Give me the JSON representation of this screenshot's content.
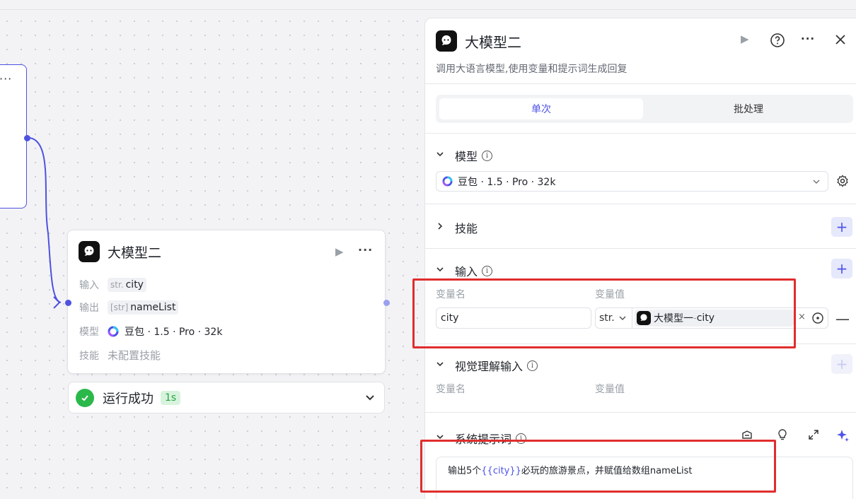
{
  "canvas": {
    "prev_node_more": "···",
    "node": {
      "title": "大模型二",
      "more": "···",
      "rows": {
        "input_label": "输入",
        "input_type": "str.",
        "input_value": "city",
        "output_label": "输出",
        "output_type": "[str]",
        "output_value": "nameList",
        "model_label": "模型",
        "model_value": "豆包 · 1.5 · Pro · 32k",
        "skill_label": "技能",
        "skill_value": "未配置技能"
      }
    },
    "status": {
      "text": "运行成功",
      "duration": "1s"
    }
  },
  "panel": {
    "title": "大模型二",
    "description": "调用大语言模型,使用变量和提示词生成回复",
    "more": "···",
    "tabs": [
      "单次",
      "批处理"
    ],
    "model_section": {
      "title": "模型",
      "selected": "豆包 · 1.5 · Pro · 32k"
    },
    "skills_section": {
      "title": "技能"
    },
    "input_section": {
      "title": "输入",
      "col_name": "变量名",
      "col_value": "变量值",
      "var_name": "city",
      "var_type": "str.",
      "ref_node": "大模型一",
      "ref_sep": " - ",
      "ref_var": "city",
      "remove": "×"
    },
    "vision_section": {
      "title": "视觉理解输入",
      "col_name": "变量名",
      "col_value": "变量值"
    },
    "system_prompt": {
      "title": "系统提示词",
      "text_before": "输出5个",
      "variable": "{{city}}",
      "text_after": "必玩的旅游景点，并赋值给数组nameList"
    }
  },
  "colors": {
    "accent": "#4d53e8",
    "success": "#2bb84a",
    "highlight_red": "#e02d2d"
  },
  "icons": [
    "bot-logo-icon",
    "play-icon",
    "help-icon",
    "more-icon",
    "close-icon",
    "info-icon",
    "chevron-down-icon",
    "gear-icon",
    "plus-icon",
    "minus-icon",
    "target-icon",
    "library-icon",
    "bulb-icon",
    "expand-icon",
    "sparkle-icon",
    "check-icon"
  ]
}
